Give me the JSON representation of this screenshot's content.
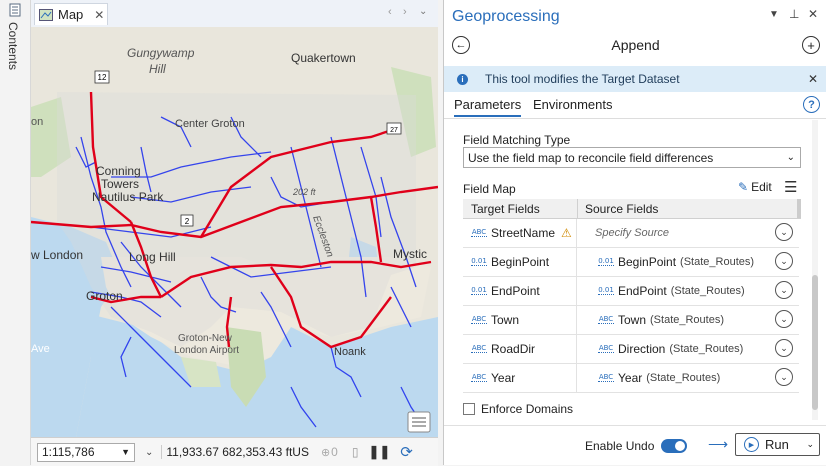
{
  "contents": {
    "label": "Contents"
  },
  "map": {
    "tab_label": "Map",
    "labels": {
      "gungywamp": "Gungywamp",
      "hill": "Hill",
      "quakertown": "Quakertown",
      "center_groton": "Center Groton",
      "conning": "Conning",
      "towers": "Towers",
      "nautilus_park": "Nautilus Park",
      "new_london": "w London",
      "long_hill": "Long Hill",
      "groton": "Groton",
      "mystic": "Mystic",
      "groton_new": "Groton-New",
      "london_airport": "London Airport",
      "noank": "Noank",
      "eccleston": "Eccleston",
      "elevation": "202 ft",
      "route_12": "12",
      "route_2": "2",
      "route_27": "27",
      "on": "on",
      "ave": "Ave"
    },
    "scale": "1:115,786",
    "coordinates": "11,933.67 682,353.43 ftUS",
    "selection_count": "0"
  },
  "gp": {
    "title": "Geoprocessing",
    "tool_name": "Append",
    "info_message": "This tool modifies the Target Dataset",
    "tabs": [
      "Parameters",
      "Environments"
    ],
    "field_matching_label": "Field Matching Type",
    "field_matching_value": "Use the field map to reconcile field differences",
    "field_map_label": "Field Map",
    "edit_label": "Edit",
    "col_target": "Target Fields",
    "col_source": "Source Fields",
    "rows": [
      {
        "type": "ABC",
        "target": "StreetName",
        "warning": true,
        "source_type": "",
        "source": "Specify Source",
        "source_table": ""
      },
      {
        "type": "0.01",
        "target": "BeginPoint",
        "warning": false,
        "source_type": "0.01",
        "source": "BeginPoint",
        "source_table": "(State_Routes)"
      },
      {
        "type": "0.01",
        "target": "EndPoint",
        "warning": false,
        "source_type": "0.01",
        "source": "EndPoint",
        "source_table": "(State_Routes)"
      },
      {
        "type": "ABC",
        "target": "Town",
        "warning": false,
        "source_type": "ABC",
        "source": "Town",
        "source_table": "(State_Routes)"
      },
      {
        "type": "ABC",
        "target": "RoadDir",
        "warning": false,
        "source_type": "ABC",
        "source": "Direction",
        "source_table": "(State_Routes)"
      },
      {
        "type": "ABC",
        "target": "Year",
        "warning": false,
        "source_type": "ABC",
        "source": "Year",
        "source_table": "(State_Routes)"
      }
    ],
    "enforce_domains_label": "Enforce Domains",
    "enable_undo_label": "Enable Undo",
    "run_label": "Run"
  },
  "colors": {
    "accent": "#2a6ebb",
    "roads_major": "#e0001a",
    "roads_local": "#2233ee",
    "water": "#bcd9ef",
    "land": "#e9e6dc"
  }
}
